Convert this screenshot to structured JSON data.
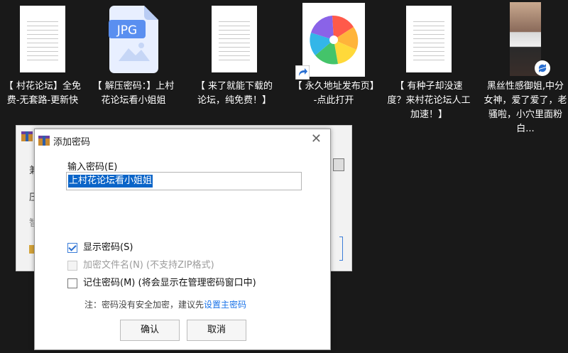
{
  "desktop": {
    "icons": [
      {
        "label": "【 村花论坛】全免费-无套路-更新快",
        "type": "document"
      },
      {
        "label": "【 解压密码：】上村花论坛看小姐姐",
        "type": "jpg",
        "badge": "JPG"
      },
      {
        "label": "【 来了就能下载的论坛，纯免费！】",
        "type": "document"
      },
      {
        "label": "【 永久地址发布页】-点此打开",
        "type": "app-shortcut"
      },
      {
        "label": "【 有种子却没速度？来村花论坛人工加速！】",
        "type": "document"
      },
      {
        "label": "黑丝性感御姐,中分女神，爱了爱了，老骚啦，小穴里面粉白...",
        "type": "photo"
      }
    ]
  },
  "background_dialog": {
    "frag1": "兼",
    "frag2": "压",
    "frag3": "智"
  },
  "dialog": {
    "title": "添加密码",
    "password_label": "输入密码(E)",
    "password_value": "上村花论坛看小姐姐",
    "show_password": {
      "label": "显示密码(S)",
      "checked": true
    },
    "encrypt_names": {
      "label": "加密文件名(N) (不支持ZIP格式)",
      "checked": false,
      "disabled": true
    },
    "remember_password": {
      "label": "记住密码(M) (将会显示在管理密码窗口中)",
      "checked": false
    },
    "note_prefix": "注：密码没有安全加密，建议先",
    "note_link": "设置主密码",
    "ok_label": "确认",
    "cancel_label": "取消"
  },
  "colors": {
    "desktop_bg": "#191919",
    "selection": "#0a64c8",
    "link": "#1a73e8",
    "jpg_blue": "#5a8ff0"
  }
}
